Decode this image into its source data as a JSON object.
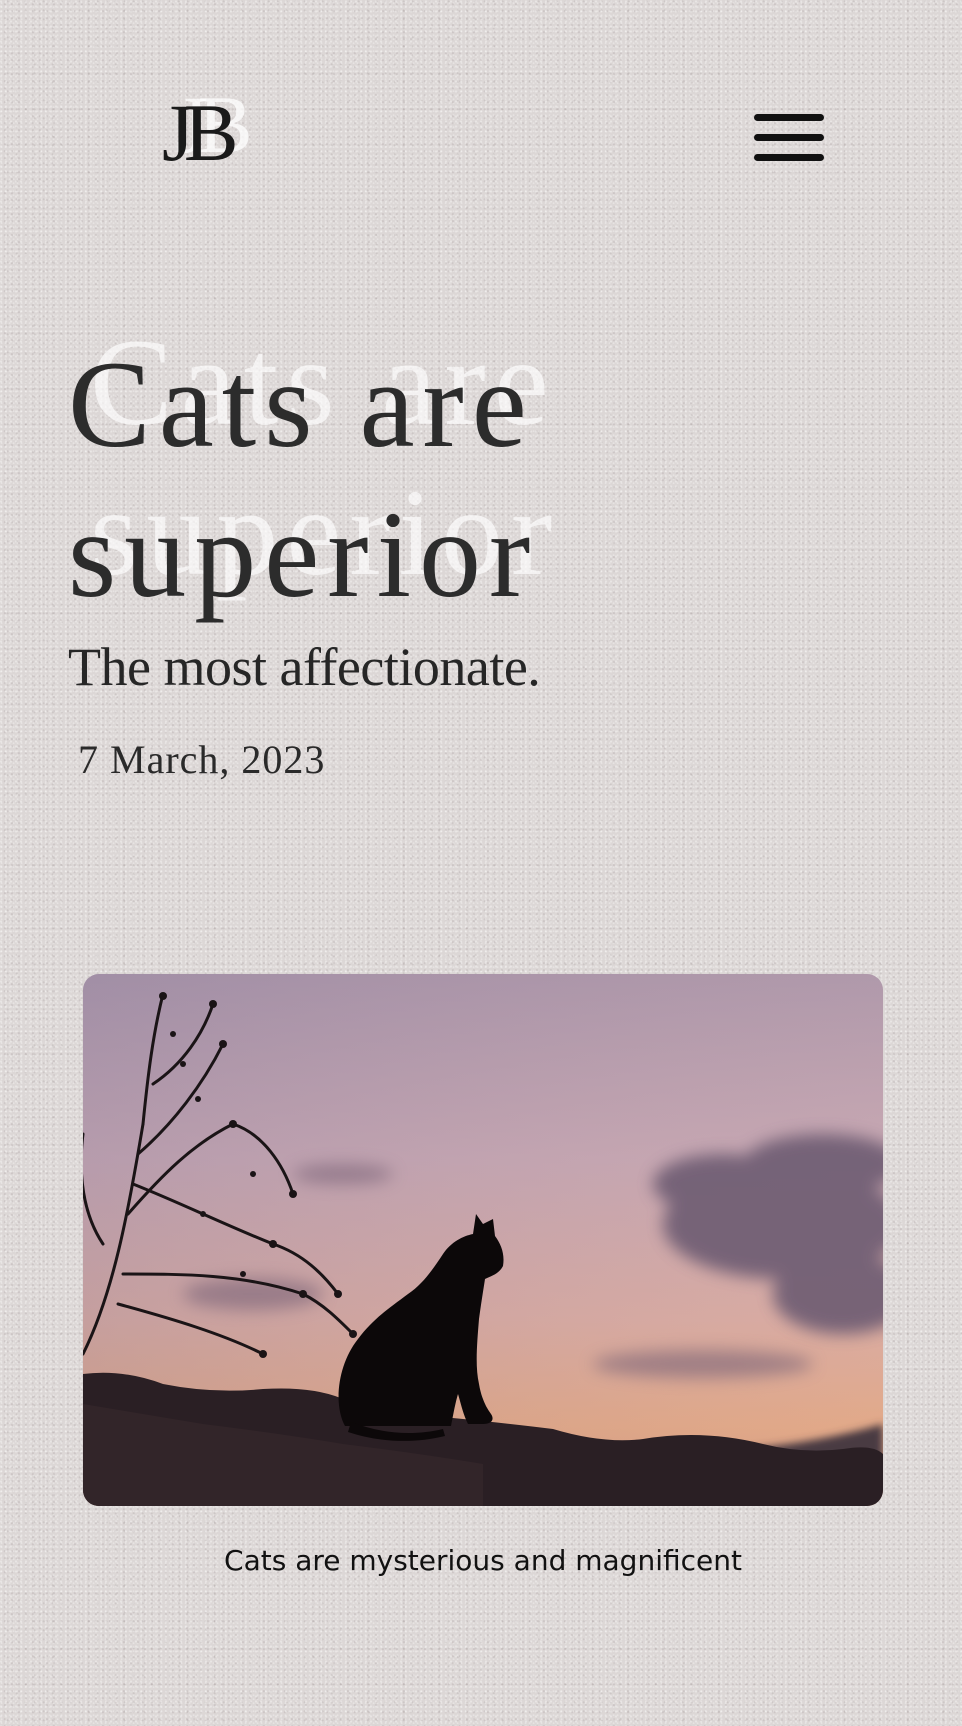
{
  "header": {
    "logo_text": "JB",
    "menu_icon": "hamburger-menu-icon"
  },
  "article": {
    "title_line_1": "Cats are",
    "title_line_2": "superior",
    "subtitle": "The most affectionate.",
    "date": "7 March, 2023"
  },
  "hero": {
    "caption": "Cats are mysterious and magnificent"
  },
  "colors": {
    "background": "#dcd7d6",
    "text_dark": "#2c2c2c",
    "menu": "#111111"
  }
}
